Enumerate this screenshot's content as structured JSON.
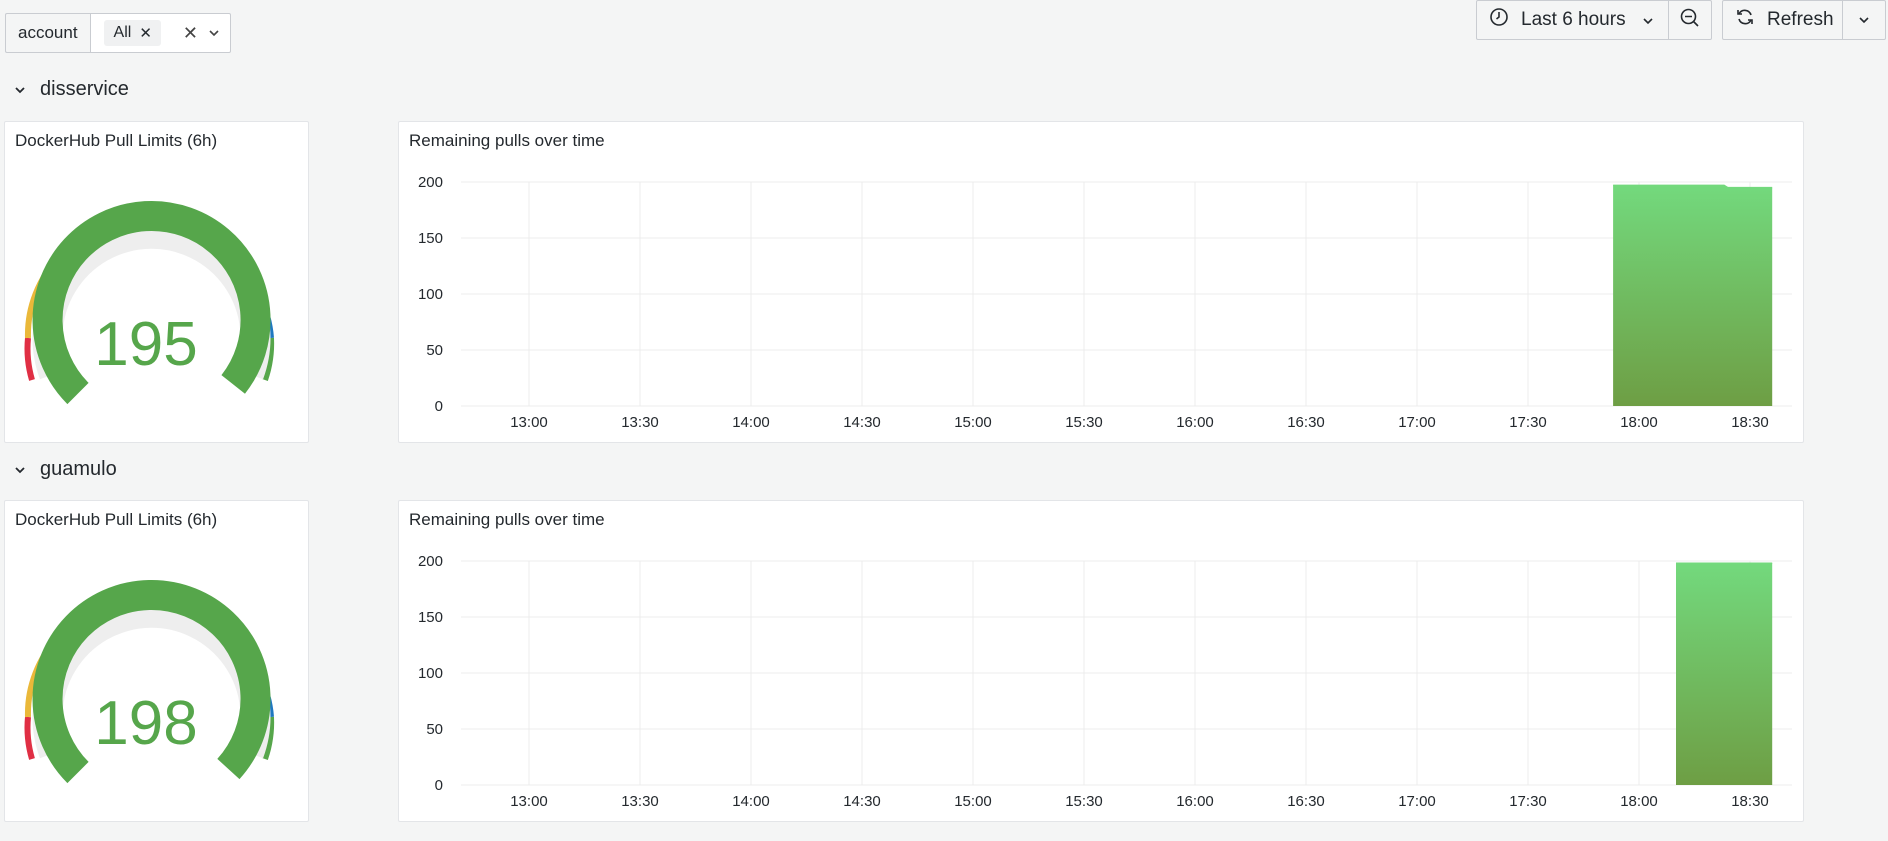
{
  "variables": {
    "label": "account",
    "selected_chip": "All"
  },
  "time_picker": {
    "label": "Last 6 hours"
  },
  "refresh": {
    "label": "Refresh"
  },
  "rows": [
    {
      "title": "disservice",
      "gauge": {
        "title": "DockerHub Pull Limits (6h)",
        "value": 195,
        "max": 200
      },
      "chart": {
        "title": "Remaining pulls over time"
      }
    },
    {
      "title": "guamulo",
      "gauge": {
        "title": "DockerHub Pull Limits (6h)",
        "value": 198,
        "max": 200
      },
      "chart": {
        "title": "Remaining pulls over time"
      }
    }
  ],
  "colors": {
    "green": "#56a64b",
    "yellow": "#eab839",
    "red": "#e02f44",
    "light_blue": "#6ed0e0",
    "blue": "#1f78c1",
    "area_top": "#73d97d",
    "area_bottom": "#6e9e44"
  },
  "chart_data": [
    {
      "type": "area",
      "title": "Remaining pulls over time",
      "x_ticks": [
        "13:00",
        "13:30",
        "14:00",
        "14:30",
        "15:00",
        "15:30",
        "16:00",
        "16:30",
        "17:00",
        "17:30",
        "18:00",
        "18:30"
      ],
      "y_ticks": [
        0,
        50,
        100,
        150,
        200
      ],
      "ylim": [
        0,
        200
      ],
      "grid": true,
      "series": [
        {
          "x": [
            "17:53",
            "18:23",
            "18:24",
            "18:36"
          ],
          "values": [
            197,
            197,
            195,
            195
          ]
        }
      ]
    },
    {
      "type": "area",
      "title": "Remaining pulls over time",
      "x_ticks": [
        "13:00",
        "13:30",
        "14:00",
        "14:30",
        "15:00",
        "15:30",
        "16:00",
        "16:30",
        "17:00",
        "17:30",
        "18:00",
        "18:30"
      ],
      "y_ticks": [
        0,
        50,
        100,
        150,
        200
      ],
      "ylim": [
        0,
        200
      ],
      "grid": true,
      "series": [
        {
          "x": [
            "18:10",
            "18:29",
            "18:30",
            "18:36"
          ],
          "values": [
            198,
            198,
            198,
            198
          ]
        }
      ]
    }
  ]
}
